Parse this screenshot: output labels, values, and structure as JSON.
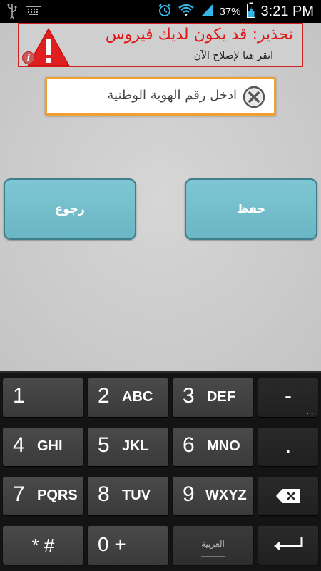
{
  "status_bar": {
    "time": "3:21 PM",
    "battery_percent": "37%",
    "icons": [
      "usb-icon",
      "keyboard-icon",
      "alarm-icon",
      "wifi-icon",
      "signal-icon",
      "battery-icon"
    ],
    "accent_color": "#33b5e5"
  },
  "warning": {
    "title": "تحذير: قد يكون لديك فيروس",
    "subtitle": "انقر هنا لإصلاح الآن",
    "info_glyph": "i",
    "border_color": "#d32020",
    "title_color": "#e01818"
  },
  "id_field": {
    "placeholder": "ادخل رقم الهوية الوطنية",
    "value": "",
    "border_color": "#f0a030"
  },
  "buttons": {
    "back_label": "رجوع",
    "save_label": "حفظ",
    "color": "#7ec6d4"
  },
  "keyboard": {
    "rows": [
      [
        {
          "num": "1",
          "letters": ""
        },
        {
          "num": "2",
          "letters": "ABC"
        },
        {
          "num": "3",
          "letters": "DEF"
        },
        {
          "label": "-"
        }
      ],
      [
        {
          "num": "4",
          "letters": "GHI"
        },
        {
          "num": "5",
          "letters": "JKL"
        },
        {
          "num": "6",
          "letters": "MNO"
        },
        {
          "label": "."
        }
      ],
      [
        {
          "num": "7",
          "letters": "PQRS"
        },
        {
          "num": "8",
          "letters": "TUV"
        },
        {
          "num": "9",
          "letters": "WXYZ"
        },
        {
          "icon": "backspace-icon"
        }
      ],
      [
        {
          "label": "* #"
        },
        {
          "label": "0 +"
        },
        {
          "label": "العربية"
        },
        {
          "icon": "enter-icon"
        }
      ]
    ]
  }
}
